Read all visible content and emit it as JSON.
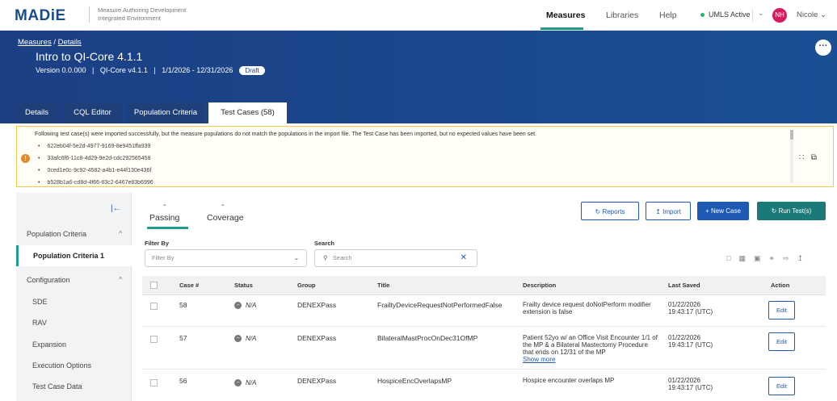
{
  "app": {
    "logo": "MADiE",
    "subtitle": "Measure Authoring Development Integrated Environment"
  },
  "nav": {
    "measures": "Measures",
    "libraries": "Libraries",
    "help": "Help",
    "umls": "UMLS Active",
    "initials": "NH",
    "user": "Nicole"
  },
  "header": {
    "breadcrumb_root": "Measures",
    "breadcrumb_sep": "/",
    "breadcrumb_leaf": "Details",
    "title": "Intro to QI-Core 4.1.1",
    "meta": "Version 0.0.000   |   QI-Core v4.1.1   |   1/1/2026 - 12/31/2026",
    "status": "Draft",
    "tabs": [
      "Details",
      "CQL Editor",
      "Population Criteria",
      "Test Cases (58)"
    ]
  },
  "alert": {
    "message": "Following test case(s) were imported successfully, but the measure populations do not match the populations in the import file. The Test Case has been imported, but no expected values have been set.",
    "items": [
      "622eb04f-5e2d-4977-9169-8e9451ffa939",
      "33afc6f6-11c8-4d29-9e2d-cdc292565458",
      "0ced1e0c-9c92-4582-a4b1-e44f130e436f",
      "b528b1a6-cd8d-4f66-83c2-6467e83b6996"
    ]
  },
  "sidebar": {
    "sections": [
      {
        "label": "Population Criteria",
        "chev": "^"
      },
      {
        "label": "Configuration",
        "chev": "^"
      }
    ],
    "items": [
      "Population Criteria 1",
      "SDE",
      "RAV",
      "Expansion",
      "Execution Options",
      "Test Case Data"
    ]
  },
  "subtabs": {
    "passing": "Passing",
    "coverage": "Coverage",
    "passing_count": "-",
    "coverage_count": "-"
  },
  "toolbar": {
    "reports": "Reports",
    "import": "Import",
    "new_case": "+ New Case",
    "run": "Run Test(s)"
  },
  "filters": {
    "filter_label": "Filter By",
    "filter_placeholder": "Filter By",
    "search_label": "Search",
    "search_placeholder": "Search"
  },
  "table": {
    "headers": [
      "Case #",
      "Status",
      "Group",
      "Title",
      "Description",
      "Last Saved",
      "Action"
    ],
    "rows": [
      {
        "case": "58",
        "status": "N/A",
        "group": "DENEXPass",
        "title": "FrailtyDeviceRequestNotPerformedFalse",
        "description": "Frailty device request doNotPerform modifier extension is false",
        "saved_date": "01/22/2026",
        "saved_time": "19:43:17 (UTC)",
        "action": "Edit"
      },
      {
        "case": "57",
        "status": "N/A",
        "group": "DENEXPass",
        "title": "BilateralMastProcOnDec31OfMP",
        "description": "Patient 52yo w/ an Office Visit Encounter 1/1 of the MP & a Bilateral Mastectomy Procedure that ends on 12/31 of the MP",
        "show_more": "Show more",
        "saved_date": "01/22/2026",
        "saved_time": "19:43:17 (UTC)",
        "action": "Edit"
      },
      {
        "case": "56",
        "status": "N/A",
        "group": "DENEXPass",
        "title": "HospiceEncOverlapsMP",
        "description": "Hospice encounter overlaps MP",
        "saved_date": "01/22/2026",
        "saved_time": "19:43:17 (UTC)",
        "action": "Edit"
      }
    ]
  },
  "colors": {
    "brand": "#1b3f84",
    "accent": "#209c8c",
    "link": "#1e5ab4",
    "alert_border": "#f2c94c",
    "alert_icon": "#e08a2e",
    "avatar": "#d81b60"
  }
}
